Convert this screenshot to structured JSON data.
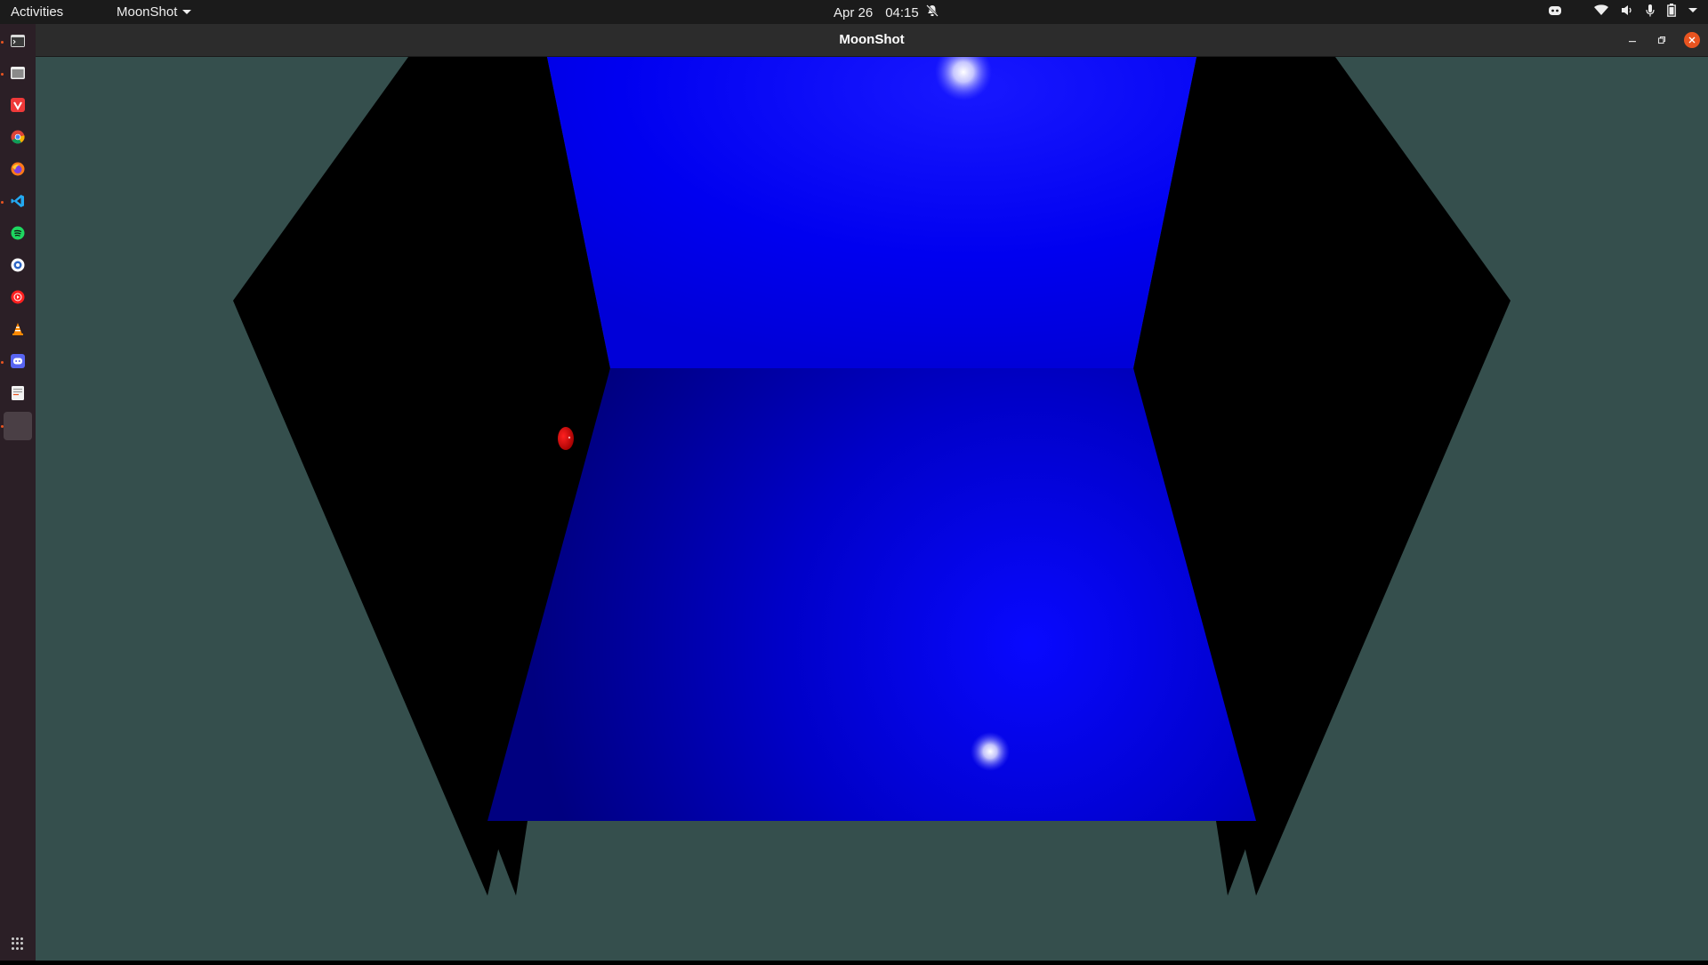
{
  "topbar": {
    "activities": "Activities",
    "app_menu": "MoonShot",
    "date": "Apr 26",
    "time": "04:15",
    "tray_icons": [
      "discord-icon",
      "wifi-icon",
      "volume-icon",
      "microphone-icon",
      "battery-icon",
      "system-menu-caret-icon"
    ]
  },
  "dock": {
    "items": [
      {
        "name": "terminal",
        "icon": "terminal-icon",
        "running": true
      },
      {
        "name": "files",
        "icon": "files-icon",
        "running": true
      },
      {
        "name": "vivaldi",
        "icon": "vivaldi-icon",
        "running": false
      },
      {
        "name": "chrome",
        "icon": "chrome-icon",
        "running": false
      },
      {
        "name": "firefox",
        "icon": "firefox-icon",
        "running": false
      },
      {
        "name": "vscode",
        "icon": "vscode-icon",
        "running": true
      },
      {
        "name": "spotify",
        "icon": "spotify-icon",
        "running": false
      },
      {
        "name": "app",
        "icon": "app-icon",
        "running": false
      },
      {
        "name": "youtube-music",
        "icon": "youtube-music-icon",
        "running": false
      },
      {
        "name": "vlc",
        "icon": "vlc-icon",
        "running": false
      },
      {
        "name": "discord",
        "icon": "discord-icon",
        "running": true
      },
      {
        "name": "text-editor",
        "icon": "text-editor-icon",
        "running": false
      },
      {
        "name": "moonshot",
        "icon": "moonshot-app-icon",
        "running": true,
        "active": true
      }
    ],
    "show_apps_icon": "show-apps-grid-icon"
  },
  "window": {
    "title": "MoonShot"
  },
  "scene": {
    "background_color": "#354f4d",
    "back_wall_color": "#0000f0",
    "floor_color": "#0000c0",
    "side_wall_color": "#000000",
    "ball_color": "#e00000",
    "light_color": "#ffffff"
  }
}
